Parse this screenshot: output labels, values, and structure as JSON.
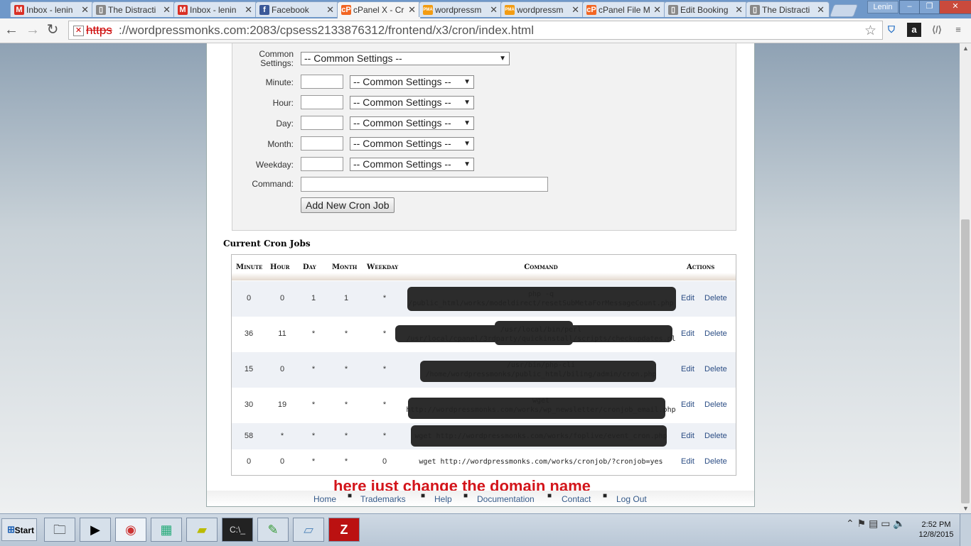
{
  "browser": {
    "tabs": [
      {
        "label": "Inbox - lenin",
        "icon": "gmail-icon",
        "glyph": "M",
        "color": "#d93025"
      },
      {
        "label": "The Distracti",
        "icon": "page-icon",
        "glyph": "▯",
        "color": "#888"
      },
      {
        "label": "Inbox - lenin",
        "icon": "gmail-icon",
        "glyph": "M",
        "color": "#d93025"
      },
      {
        "label": "Facebook",
        "icon": "facebook-icon",
        "glyph": "f",
        "color": "#3b5998"
      },
      {
        "label": "cPanel X - Cr",
        "icon": "cpanel-icon",
        "glyph": "cP",
        "color": "#f26522"
      },
      {
        "label": "wordpressm",
        "icon": "phpmyadmin-icon",
        "glyph": "PMA",
        "color": "#f39c12"
      },
      {
        "label": "wordpressm",
        "icon": "phpmyadmin-icon",
        "glyph": "PMA",
        "color": "#f39c12"
      },
      {
        "label": "cPanel File M",
        "icon": "cpanel-icon",
        "glyph": "cP",
        "color": "#f26522"
      },
      {
        "label": "Edit Booking",
        "icon": "page-icon",
        "glyph": "▯",
        "color": "#888"
      },
      {
        "label": "The Distracti",
        "icon": "page-icon",
        "glyph": "▯",
        "color": "#888"
      }
    ],
    "active_tab_index": 4,
    "user_label": "Lenin",
    "url_scheme": "https",
    "url_rest": "://wordpressmonks.com:2083/cpsess2133876312/frontend/x3/cron/index.html"
  },
  "form": {
    "common_label": "Common Settings:",
    "common_value": "-- Common Settings --",
    "fields": [
      {
        "label": "Minute:",
        "select": "-- Common Settings --"
      },
      {
        "label": "Hour:",
        "select": "-- Common Settings --"
      },
      {
        "label": "Day:",
        "select": "-- Common Settings --"
      },
      {
        "label": "Month:",
        "select": "-- Common Settings --"
      },
      {
        "label": "Weekday:",
        "select": "-- Common Settings --"
      }
    ],
    "command_label": "Command:",
    "add_button": "Add New Cron Job"
  },
  "jobs": {
    "title": "Current Cron Jobs",
    "headers": [
      "Minute",
      "Hour",
      "Day",
      "Month",
      "Weekday",
      "Command",
      "Actions"
    ],
    "edit_label": "Edit",
    "delete_label": "Delete",
    "rows": [
      {
        "minute": "0",
        "hour": "0",
        "day": "1",
        "month": "1",
        "weekday": "*",
        "cmd1": "php -q",
        "cmd2": "/public_html/works/modeldirect/resetSubMetaForMessageCount.php"
      },
      {
        "minute": "36",
        "hour": "11",
        "day": "*",
        "month": "*",
        "weekday": "*",
        "cmd1": "/usr/local/bin/perl",
        "cmd2": "/usr/local/cpanel/3rdparty/quickinstall/scripts/checkupdates.pl"
      },
      {
        "minute": "15",
        "hour": "0",
        "day": "*",
        "month": "*",
        "weekday": "*",
        "cmd1": "/usr/bin/php-cli",
        "cmd2": "/home/wordpressmonks/public_html/biling/admin/cron.php"
      },
      {
        "minute": "30",
        "hour": "19",
        "day": "*",
        "month": "*",
        "weekday": "*",
        "cmd1": "wget",
        "cmd2": "http://wordpressmonks.com/works/wp_newsletter/cronjob_email.php"
      },
      {
        "minute": "58",
        "hour": "*",
        "day": "*",
        "month": "*",
        "weekday": "*",
        "cmd1": "wget http://wordpressmonks.com/works/foplive/event_cron.php",
        "cmd2": ""
      },
      {
        "minute": "0",
        "hour": "0",
        "day": "*",
        "month": "*",
        "weekday": "0",
        "cmd1": "wget http://wordpressmonks.com/works/cronjob/?cronjob=yes",
        "cmd2": ""
      }
    ]
  },
  "annotation": "here just change the domain name",
  "footer": {
    "links": [
      "Home",
      "Trademarks",
      "Help",
      "Documentation",
      "Contact",
      "Log Out"
    ]
  },
  "taskbar": {
    "start_label": "Start",
    "clock_time": "2:52 PM",
    "clock_date": "12/8/2015"
  }
}
